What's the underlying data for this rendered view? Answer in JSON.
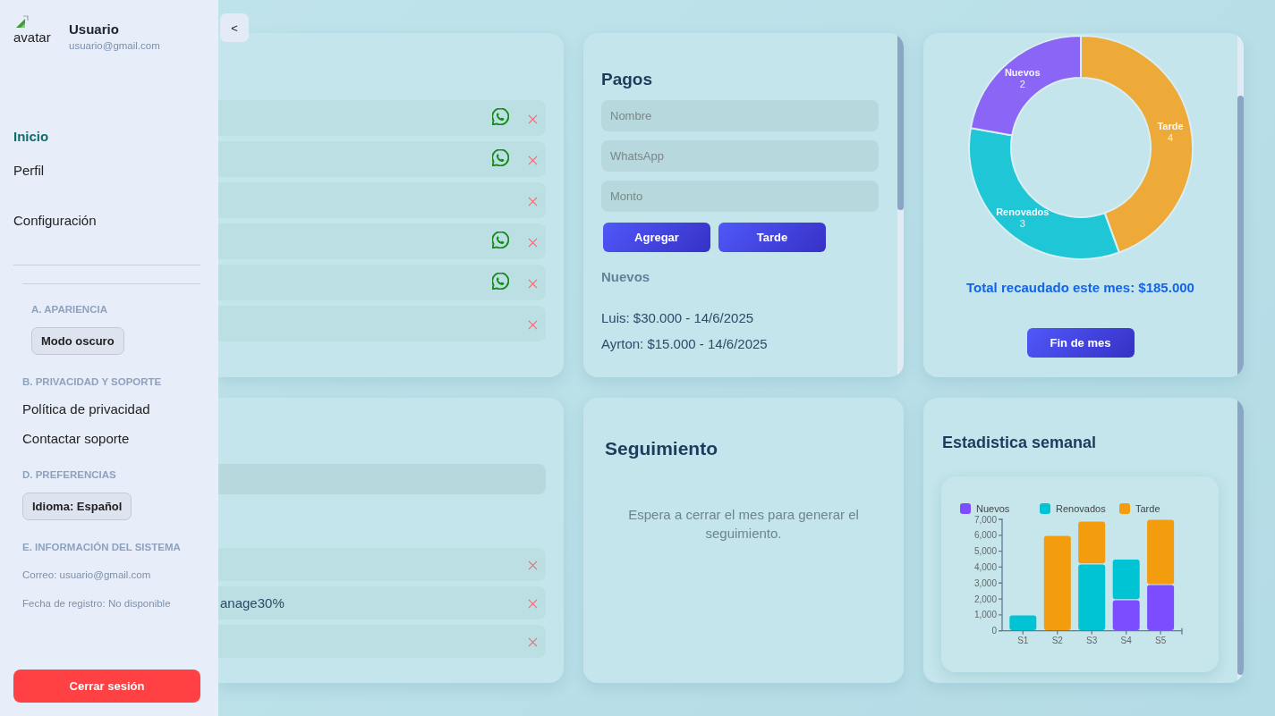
{
  "sidebar": {
    "avatar_alt": "avatar",
    "user_name": "Usuario",
    "user_email": "usuario@gmail.com",
    "nav": [
      {
        "label": "Inicio",
        "selected": true
      },
      {
        "label": "Perfil",
        "selected": false
      },
      {
        "label": "Configuración",
        "selected": false
      }
    ],
    "sections": [
      {
        "heading": "A. APARIENCIA",
        "items": [
          {
            "kind": "button",
            "label": "Modo oscuro"
          }
        ]
      },
      {
        "heading": "B. PRIVACIDAD Y SOPORTE",
        "items": [
          {
            "kind": "link",
            "label": "Política de privacidad"
          },
          {
            "kind": "link",
            "label": "Contactar soporte"
          }
        ]
      },
      {
        "heading": "D. PREFERENCIAS",
        "items": [
          {
            "kind": "button",
            "label": "Idioma: Español"
          }
        ]
      },
      {
        "heading": "E. INFORMACIÓN DEL SISTEMA",
        "items": [
          {
            "kind": "info",
            "label": "Correo: usuario@gmail.com"
          },
          {
            "kind": "info",
            "label": "Fecha de registro: No disponible"
          }
        ]
      }
    ],
    "logout_button": "Cerrar sesión"
  },
  "collapse_button": "<",
  "client_list": {
    "rows": [
      {
        "chat_icon": true,
        "removable": true
      },
      {
        "chat_icon": true,
        "removable": true
      },
      {
        "chat_icon": false,
        "removable": true
      },
      {
        "chat_icon": true,
        "removable": true
      },
      {
        "chat_icon": true,
        "removable": true
      },
      {
        "chat_icon": false,
        "removable": true
      }
    ]
  },
  "payments": {
    "title": "Pagos",
    "fields": [
      {
        "placeholder": "Nombre"
      },
      {
        "placeholder": "WhatsApp"
      },
      {
        "placeholder": "Monto"
      }
    ],
    "buttons": [
      "Agregar",
      "Tarde"
    ],
    "groups": [
      {
        "heading": "Nuevos",
        "entries": [
          "Luis: $30.000 - 14/6/2025",
          "Ayrton: $15.000 - 14/6/2025"
        ]
      }
    ]
  },
  "summary": {
    "chart_data": {
      "type": "donut",
      "categories": [
        "Tarde",
        "Renovados",
        "Nuevos"
      ],
      "values": [
        4,
        3,
        2
      ],
      "colors": [
        "#eeaa38",
        "#1ec6d6",
        "#8b66f6"
      ],
      "data_labels": true
    },
    "total": "Total recaudado este mes: $185.000",
    "button": "Fin de mes"
  },
  "lower_list": {
    "input_field": true,
    "rows": [
      {
        "removable": true
      },
      {
        "text": "anage30%",
        "removable": true
      },
      {
        "removable": true
      }
    ]
  },
  "follow_up": {
    "title": "Seguimiento",
    "message": "Espera a cerrar el mes para generar el seguimiento."
  },
  "weekly_stats": {
    "title": "Estadistica semanal",
    "chart_data": {
      "type": "bar",
      "stacked": true,
      "legend": true,
      "categories": [
        "S1",
        "S2",
        "S3",
        "S4",
        "S5"
      ],
      "series": [
        {
          "name": "Nuevos",
          "color": "#7c4dff",
          "values": [
            0,
            0,
            0,
            1950,
            2900
          ]
        },
        {
          "name": "Renovados",
          "color": "#00c4d4",
          "values": [
            1000,
            0,
            4200,
            2550,
            0
          ]
        },
        {
          "name": "Tarde",
          "color": "#f39c0e",
          "values": [
            0,
            6000,
            2700,
            0,
            4100
          ]
        }
      ],
      "ylim": [
        0,
        7000
      ],
      "yticks": [
        {
          "value": 0,
          "label": "0"
        },
        {
          "value": 1000,
          "label": "1,000"
        },
        {
          "value": 2000,
          "label": "2,000"
        },
        {
          "value": 3000,
          "label": "3,000"
        },
        {
          "value": 4000,
          "label": "4,000"
        },
        {
          "value": 5000,
          "label": "5,000"
        },
        {
          "value": 6000,
          "label": "6,000"
        },
        {
          "value": 7000,
          "label": "7,000"
        }
      ]
    }
  }
}
